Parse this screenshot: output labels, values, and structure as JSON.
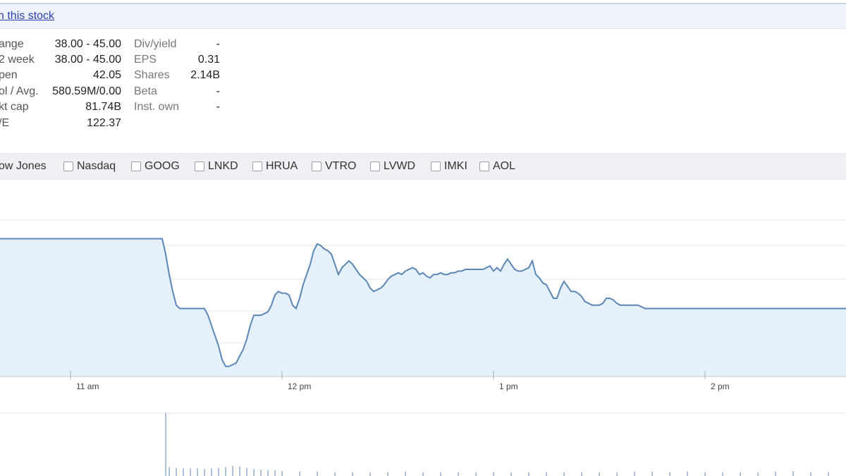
{
  "watch_link": "h this stock",
  "stats_left": [
    {
      "label": "ange",
      "value": "38.00 - 45.00"
    },
    {
      "label": "2 week",
      "value": "38.00 - 45.00"
    },
    {
      "label": "pen",
      "value": "42.05"
    },
    {
      "label": "ol / Avg.",
      "value": "580.59M/0.00"
    },
    {
      "label": "kt cap",
      "value": "81.74B"
    },
    {
      "label": "/E",
      "value": "122.37"
    }
  ],
  "stats_right": [
    {
      "label": "Div/yield",
      "value": "-"
    },
    {
      "label": "EPS",
      "value": "0.31"
    },
    {
      "label": "Shares",
      "value": "2.14B"
    },
    {
      "label": "Beta",
      "value": "-"
    },
    {
      "label": "Inst. own",
      "value": "-"
    }
  ],
  "compare": [
    "ow Jones",
    "Nasdaq",
    "GOOG",
    "LNKD",
    "HRUA",
    "VTRO",
    "LVWD",
    "IMKI",
    "AOL"
  ],
  "colors": {
    "line": "#5a87b8",
    "fill": "#e6f0fb",
    "link": "#2a3fb0",
    "volume": "#8aa6c8"
  },
  "chart_data": {
    "type": "area",
    "x_ticks": [
      "11 am",
      "12 pm",
      "1 pm",
      "2 pm"
    ],
    "x_tick_minutes": [
      660,
      720,
      780,
      840
    ],
    "x": [
      640,
      641,
      642,
      643,
      644,
      645,
      646,
      647,
      648,
      649,
      650,
      651,
      652,
      653,
      654,
      655,
      656,
      657,
      658,
      659,
      660,
      661,
      662,
      663,
      664,
      665,
      666,
      667,
      668,
      669,
      670,
      671,
      672,
      673,
      674,
      675,
      676,
      677,
      678,
      679,
      680,
      681,
      682,
      683,
      684,
      685,
      686,
      687,
      688,
      689,
      690,
      691,
      692,
      693,
      694,
      695,
      696,
      697,
      698,
      699,
      700,
      701,
      702,
      703,
      704,
      705,
      706,
      707,
      708,
      709,
      710,
      711,
      712,
      713,
      714,
      715,
      716,
      717,
      718,
      719,
      720,
      721,
      722,
      723,
      724,
      725,
      726,
      727,
      728,
      729,
      730,
      731,
      732,
      733,
      734,
      735,
      736,
      737,
      738,
      739,
      740,
      741,
      742,
      743,
      744,
      745,
      746,
      747,
      748,
      749,
      750,
      751,
      752,
      753,
      754,
      755,
      756,
      757,
      758,
      759,
      760,
      761,
      762,
      763,
      764,
      765,
      766,
      767,
      768,
      769,
      770,
      771,
      772,
      773,
      774,
      775,
      776,
      777,
      778,
      779,
      780,
      781,
      782,
      783,
      784,
      785,
      786,
      787,
      788,
      789,
      790,
      791,
      792,
      793,
      794,
      795,
      796,
      797,
      798,
      799,
      800,
      801,
      802,
      803,
      804,
      805,
      806,
      807,
      808,
      809,
      810,
      811,
      812,
      813,
      814,
      815,
      816,
      817,
      818,
      819,
      820,
      821,
      822,
      823,
      824,
      825,
      826,
      827,
      828,
      829,
      830,
      831,
      832,
      833,
      834,
      835,
      836,
      837,
      838,
      839,
      840,
      841,
      842,
      843,
      844,
      845,
      846,
      847,
      848,
      849,
      850,
      851,
      852,
      853,
      854,
      855,
      856,
      857,
      858,
      859,
      860,
      861,
      862,
      863,
      864,
      865,
      866,
      867,
      868,
      869,
      870,
      871,
      872,
      873,
      874,
      875,
      876,
      877,
      878,
      879,
      880
    ],
    "y": [
      42.05,
      42.05,
      42.05,
      42.05,
      42.05,
      42.05,
      42.05,
      42.05,
      42.05,
      42.05,
      42.05,
      42.05,
      42.05,
      42.05,
      42.05,
      42.05,
      42.05,
      42.05,
      42.05,
      42.05,
      42.05,
      42.05,
      42.05,
      42.05,
      42.05,
      42.05,
      42.05,
      42.05,
      42.05,
      42.05,
      42.05,
      42.05,
      42.05,
      42.05,
      42.05,
      42.05,
      42.05,
      42.05,
      42.05,
      42.05,
      42.05,
      42.05,
      42.05,
      42.05,
      42.05,
      42.05,
      42.05,
      41.6,
      41.0,
      40.5,
      40.1,
      40.0,
      40.0,
      40.0,
      40.0,
      40.0,
      40.0,
      40.0,
      40.0,
      39.8,
      39.5,
      39.2,
      38.9,
      38.5,
      38.3,
      38.3,
      38.35,
      38.4,
      38.6,
      38.8,
      39.1,
      39.5,
      39.8,
      39.8,
      39.8,
      39.85,
      39.9,
      40.1,
      40.4,
      40.5,
      40.45,
      40.45,
      40.4,
      40.1,
      40.0,
      40.3,
      40.7,
      41.0,
      41.3,
      41.7,
      41.9,
      41.85,
      41.75,
      41.7,
      41.6,
      41.3,
      41.0,
      41.2,
      41.3,
      41.4,
      41.3,
      41.15,
      41.0,
      40.9,
      40.8,
      40.6,
      40.5,
      40.55,
      40.6,
      40.7,
      40.85,
      40.95,
      41.0,
      41.05,
      41.0,
      41.1,
      41.15,
      41.2,
      41.15,
      41.0,
      41.05,
      40.95,
      40.9,
      41.0,
      41.0,
      41.05,
      41.0,
      41.0,
      41.05,
      41.05,
      41.1,
      41.1,
      41.15,
      41.15,
      41.15,
      41.15,
      41.15,
      41.15,
      41.2,
      41.25,
      41.1,
      41.2,
      41.1,
      41.3,
      41.45,
      41.3,
      41.15,
      41.1,
      41.1,
      41.15,
      41.2,
      41.4,
      41.0,
      40.9,
      40.75,
      40.7,
      40.5,
      40.3,
      40.3,
      40.6,
      40.8,
      40.65,
      40.5,
      40.5,
      40.45,
      40.35,
      40.2,
      40.15,
      40.1,
      40.1,
      40.1,
      40.15,
      40.3,
      40.3,
      40.25,
      40.15,
      40.1,
      40.1,
      40.1,
      40.1,
      40.1,
      40.1,
      40.05,
      40.0,
      40.0,
      40.0,
      40.0,
      40.0,
      40.0,
      40.0,
      40.0,
      40.0,
      40.0,
      40.0,
      40.0,
      40.0,
      40.0,
      40.0,
      40.0,
      40.0,
      40.0,
      40.0,
      40.0,
      40.0,
      40.0,
      40.0,
      40.0,
      40.0,
      40.0,
      40.0,
      40.0,
      40.0,
      40.0,
      40.0,
      40.0,
      40.0,
      40.0,
      40.0,
      40.0,
      40.0,
      40.0,
      40.0,
      40.0,
      40.0,
      40.0,
      40.0,
      40.0,
      40.0,
      40.0,
      40.0,
      40.0,
      40.0,
      40.0,
      40.0,
      40.0,
      40.0,
      40.0,
      40.0,
      40.0,
      40.0,
      40.0,
      40.0,
      40.0,
      40.0,
      40.0,
      40.0,
      40.0,
      40.0,
      40.0,
      40.0,
      40.0,
      40.0,
      40.0,
      40.0,
      40.0,
      40.0,
      40.0,
      40.0,
      40.0,
      40.0,
      40.0,
      40.0,
      40.0,
      40.0,
      40.0
    ],
    "ylim": [
      38.0,
      42.6
    ],
    "grid": true
  },
  "volume_data": {
    "x": [
      687,
      688,
      690,
      692,
      694,
      696,
      698,
      700,
      702,
      704,
      706,
      708,
      710,
      712,
      714,
      716,
      718,
      720,
      725,
      730,
      735,
      740,
      745,
      750,
      755,
      760,
      765,
      770,
      775,
      780,
      785,
      790,
      795,
      800,
      805,
      810,
      815,
      820,
      825,
      830,
      835,
      840,
      845,
      850,
      855,
      860,
      865,
      870,
      875
    ],
    "v": [
      100,
      14,
      13,
      12,
      12,
      12,
      11,
      12,
      13,
      14,
      16,
      15,
      13,
      11,
      10,
      9,
      9,
      8,
      7,
      7,
      6,
      6,
      6,
      6,
      7,
      6,
      6,
      6,
      6,
      6,
      6,
      6,
      6,
      6,
      6,
      6,
      6,
      7,
      7,
      6,
      7,
      6,
      6,
      6,
      6,
      7,
      8,
      6,
      6
    ],
    "ylim": [
      0,
      100
    ]
  }
}
